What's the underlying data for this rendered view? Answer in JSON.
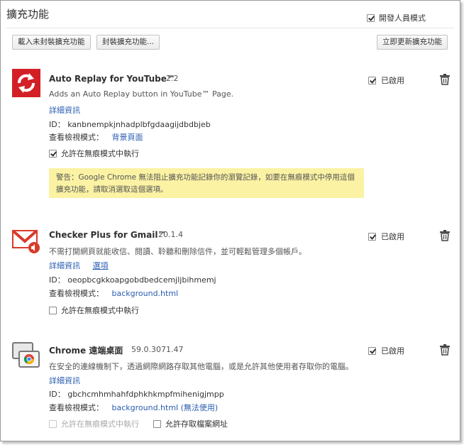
{
  "page": {
    "title": "擴充功能"
  },
  "dev_mode": {
    "label": "開發人員模式",
    "checked": true
  },
  "toolbar": {
    "load_unpacked": "載入未封裝擴充功能",
    "pack": "封裝擴充功能...",
    "update_now": "立即更新擴充功能"
  },
  "extensions": [
    {
      "name": "Auto Replay for YouTube™",
      "version": "2.2",
      "description": "Adds an Auto Replay button in YouTube™ Page.",
      "details_link": "詳細資訊",
      "id_label": "ID：",
      "id": "kanbnempkjnhadplbfgdaagijdbdbjeb",
      "inspect_label": "查看檢視模式：",
      "inspect_link": "背景頁面",
      "enabled_label": "已啟用",
      "enabled": true,
      "incognito_label": "允許在無痕模式中執行",
      "incognito": true,
      "warning": "警告：Google Chrome 無法阻止擴充功能記錄你的瀏覽記錄，如要在無痕模式中停用這個擴充功能，請取消選取這個選項。",
      "icon": "replay-arrows-icon",
      "icon_color": "#d32027"
    },
    {
      "name": "Checker Plus for Gmail™",
      "version": "20.1.4",
      "description": "不需打開網頁就能收信、閱讀、聆聽和刪除信件，並可輕鬆管理多個帳戶。",
      "details_link": "詳細資訊",
      "options_link": "選項",
      "id_label": "ID：",
      "id": "oeopbcgkkoapgobdbedcemjljbihmemj",
      "inspect_label": "查看檢視模式：",
      "inspect_link": "background.html",
      "enabled_label": "已啟用",
      "enabled": true,
      "incognito_label": "允許在無痕模式中執行",
      "incognito": false,
      "icon": "gmail-envelope-icon",
      "icon_color": "#d93a2b"
    },
    {
      "name": "Chrome 遠端桌面",
      "version": "59.0.3071.47",
      "description": "在安全的連線機制下，透過網際網路存取其他電腦，或是允許其他使用者存取你的電腦。",
      "details_link": "詳細資訊",
      "id_label": "ID：",
      "id": "gbchcmhmhahfdphkhkmpfmihenigjmpp",
      "inspect_label": "查看檢視模式：",
      "inspect_link": "background.html (無法使用)",
      "enabled_label": "已啟用",
      "enabled": true,
      "incognito_label": "允許在無痕模式中執行",
      "incognito": false,
      "file_access_label": "允許存取檔案網址",
      "file_access": false,
      "icon": "remote-desktop-icon"
    }
  ],
  "icons": {
    "trash": "trash-icon",
    "check": "checkmark-icon"
  }
}
